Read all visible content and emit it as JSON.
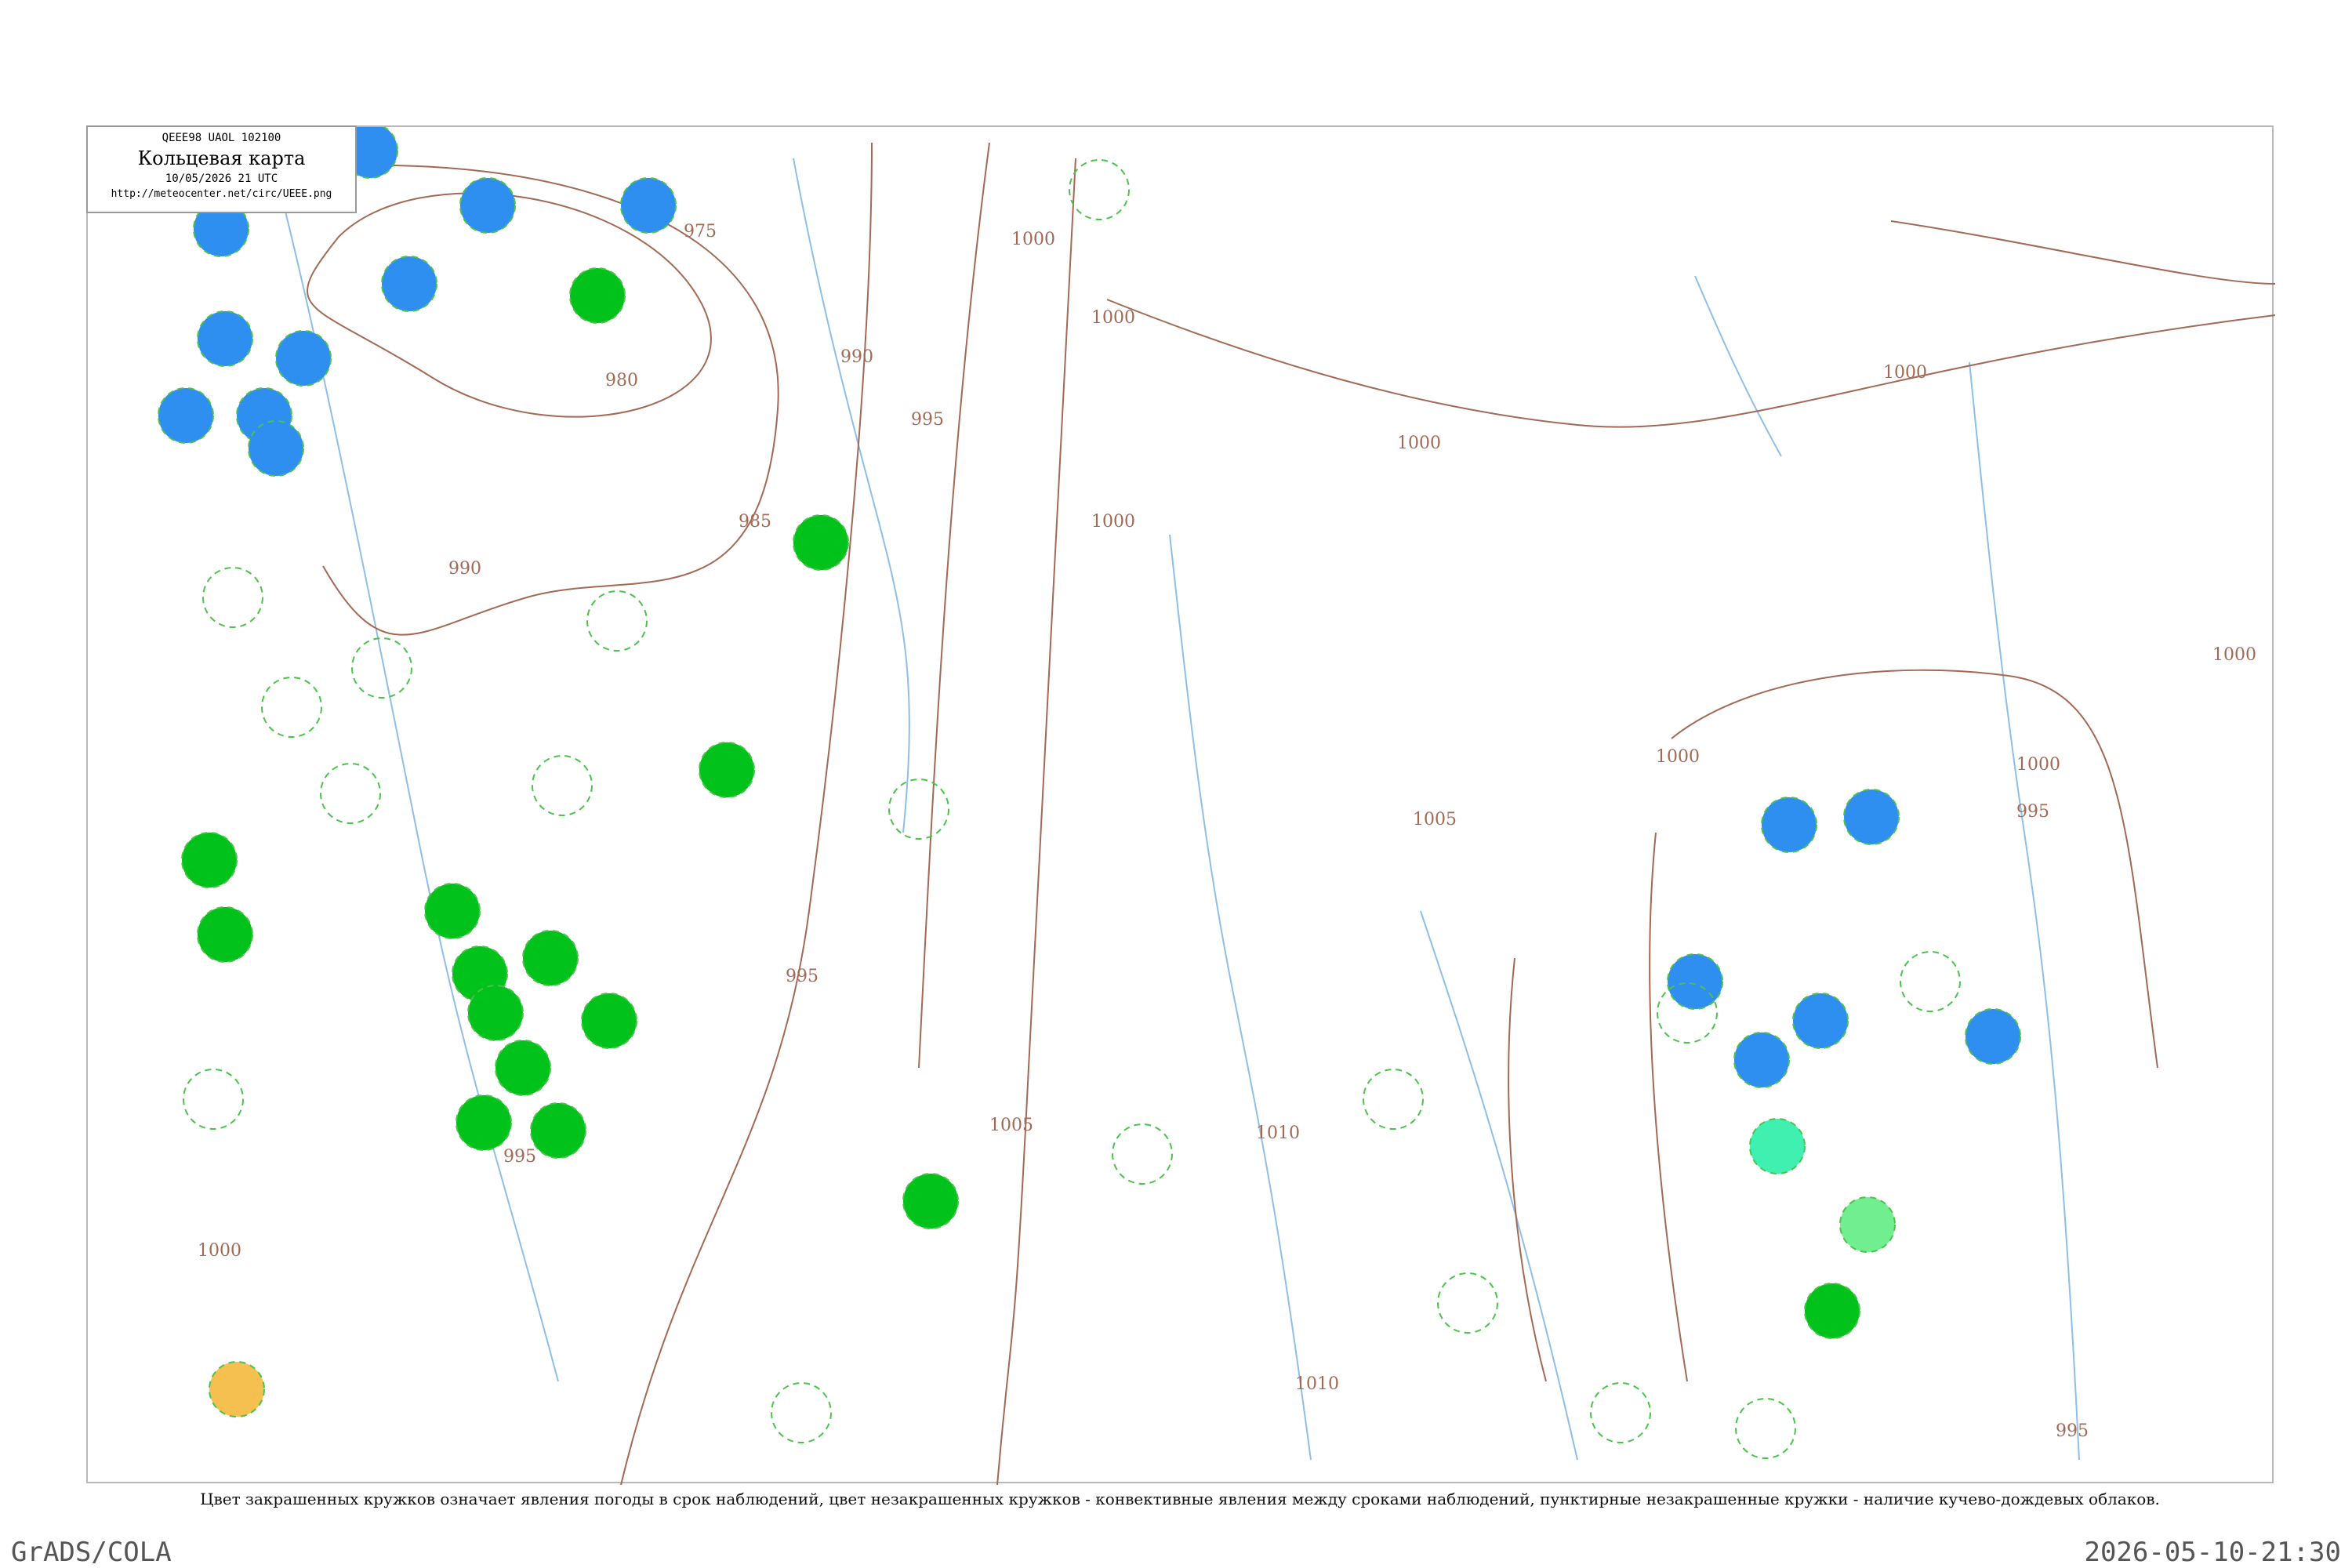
{
  "title_box": {
    "code": "QEEE98  UAOL  102100",
    "title": "Кольцевая карта",
    "datetime": "10/05/2026 21 UTC",
    "url": "http://meteocenter.net/circ/UEEE.png"
  },
  "isobar_labels": [
    "975",
    "980",
    "985",
    "990",
    "990",
    "995",
    "995",
    "995",
    "995",
    "995",
    "1000",
    "1000",
    "1000",
    "1000",
    "1000",
    "1000",
    "1000",
    "1000",
    "1000",
    "1005",
    "1005",
    "1010",
    "1010"
  ],
  "caption": "Цвет закрашенных кружков означает явления погоды в срок наблюдений, цвет незакрашенных кружков - конвективные явления между сроками наблюдений, пунктирные незакрашенные кружки - наличие кучево-дождевых облаков.",
  "credit_left": "GrADS/COLA",
  "credit_right": "2026-05-10-21:30",
  "colors": {
    "isobar": "#a26a55",
    "river": "#8fbfe6",
    "coast": "#7fb2e0",
    "phenomenon_blue": "#2f8ff0",
    "phenomenon_green": "#00c21a",
    "phenomenon_teal": "#3ff0b0",
    "phenomenon_lightgreen": "#70ee90",
    "phenomenon_orange": "#f5c04f",
    "convective_ring": "#4cc24c"
  }
}
